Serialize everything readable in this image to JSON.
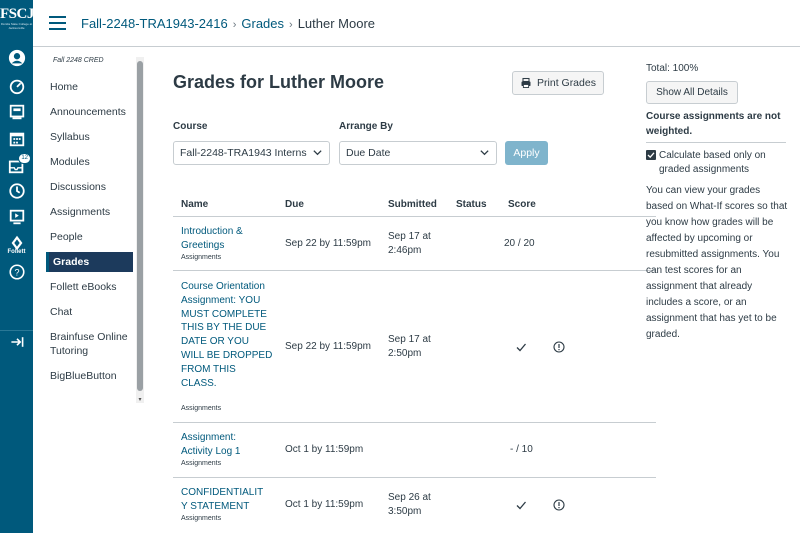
{
  "global_nav": {
    "logo_text": "FSCJ",
    "logo_subtext": "Florida State College at Jacksonville",
    "inbox_badge": "12",
    "follett_label": "Follett",
    "collapse_icon": "collapse-arrow-icon"
  },
  "header": {
    "breadcrumbs": [
      "Fall-2248-TRA1943-2416",
      "Grades",
      "Luther Moore"
    ]
  },
  "course_nav": {
    "term": "Fall 2248 CRED",
    "items": [
      "Home",
      "Announcements",
      "Syllabus",
      "Modules",
      "Discussions",
      "Assignments",
      "People",
      "Grades",
      "Follett eBooks",
      "Chat",
      "Brainfuse Online Tutoring",
      "BigBlueButton"
    ],
    "active": "Grades"
  },
  "main": {
    "title": "Grades for Luther Moore",
    "print_label": "Print Grades",
    "course_label": "Course",
    "course_value": "Fall-2248-TRA1943 Interns",
    "arrange_label": "Arrange By",
    "arrange_value": "Due Date",
    "apply_label": "Apply",
    "columns": [
      "Name",
      "Due",
      "Submitted",
      "Status",
      "Score"
    ],
    "rows": [
      {
        "name": "Introduction & Greetings",
        "type": "Assignments",
        "due": "Sep 22 by 11:59pm",
        "submitted": "Sep 17 at 2:46pm",
        "score": "20 / 20",
        "icons": []
      },
      {
        "name": "Course Orientation Assignment: YOU MUST COMPLETE THIS BY THE DUE DATE OR YOU WILL BE DROPPED FROM THIS CLASS.",
        "type": "Assignments",
        "due": "Sep 22 by 11:59pm",
        "submitted": "Sep 17 at 2:50pm",
        "score": "",
        "icons": [
          "checkmark-icon",
          "info-icon"
        ]
      },
      {
        "name": "Assignment: Activity Log 1",
        "type": "Assignments",
        "due": "Oct 1 by 11:59pm",
        "submitted": "",
        "score": "- / 10",
        "icons": []
      },
      {
        "name": "CONFIDENTIALITY STATEMENT",
        "type": "Assignments",
        "due": "Oct 1 by 11:59pm",
        "submitted": "Sep 26 at 3:50pm",
        "score": "",
        "icons": [
          "checkmark-icon",
          "info-icon"
        ]
      }
    ]
  },
  "right_panel": {
    "total": "Total: 100%",
    "show_details_label": "Show All Details",
    "weighting_note": "Course assignments are not weighted.",
    "checkbox_label": "Calculate based only on graded assignments",
    "checkbox_checked": true,
    "whatif_text": "You can view your grades based on What-If scores so that you know how grades will be affected by upcoming or resubmitted assignments. You can test scores for an assignment that already includes a score, or an assignment that has yet to be graded."
  }
}
